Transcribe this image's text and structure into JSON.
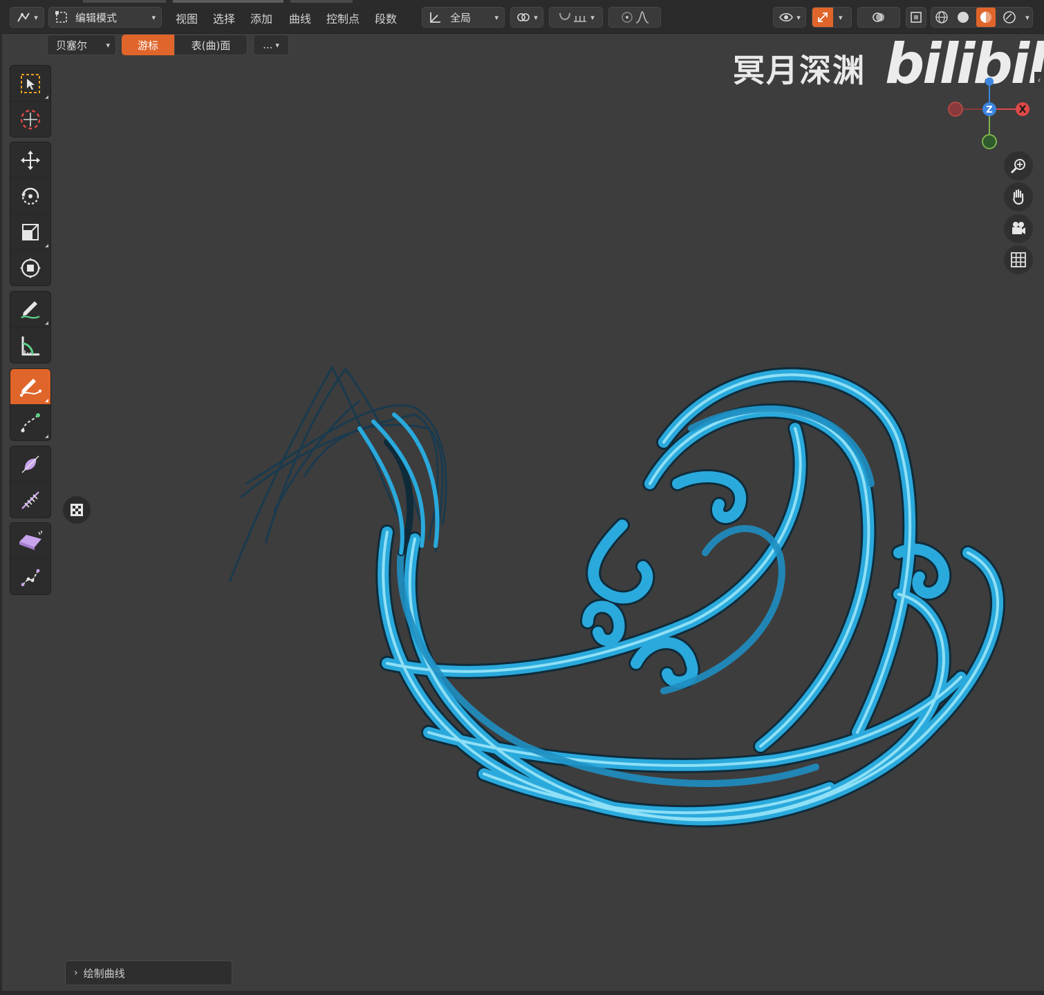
{
  "header": {
    "mode_label": "编辑模式",
    "menus": [
      "视图",
      "选择",
      "添加",
      "曲线",
      "控制点",
      "段数"
    ],
    "transform_orientation": "全局"
  },
  "subbar": {
    "curve_type": "贝塞尔",
    "placement_buttons": [
      "游标",
      "表(曲)面"
    ],
    "more_label": "..."
  },
  "watermark": {
    "text": "冥月深渊",
    "logo": "bilibili"
  },
  "gizmo": {
    "axis_x": "X",
    "axis_z": "Z"
  },
  "last_operator": {
    "label": "绘制曲线"
  },
  "colors": {
    "accent": "#e0652a",
    "curve_fill": "#2aa9dc",
    "curve_highlight": "#8fe0f6",
    "axis_x": "#e04848",
    "axis_y": "#7fb24c",
    "axis_z": "#3d86e0"
  },
  "toolbar": {
    "tools": [
      "select-box-icon",
      "cursor-icon",
      "move-icon",
      "rotate-icon",
      "scale-icon",
      "transform-icon",
      "annotate-icon",
      "measure-icon",
      "draw-curve-icon",
      "extrude-curve-icon",
      "radius-icon",
      "tilt-icon",
      "randomize-icon",
      "curve-pen-icon"
    ],
    "active_tool": "draw-curve-icon"
  }
}
